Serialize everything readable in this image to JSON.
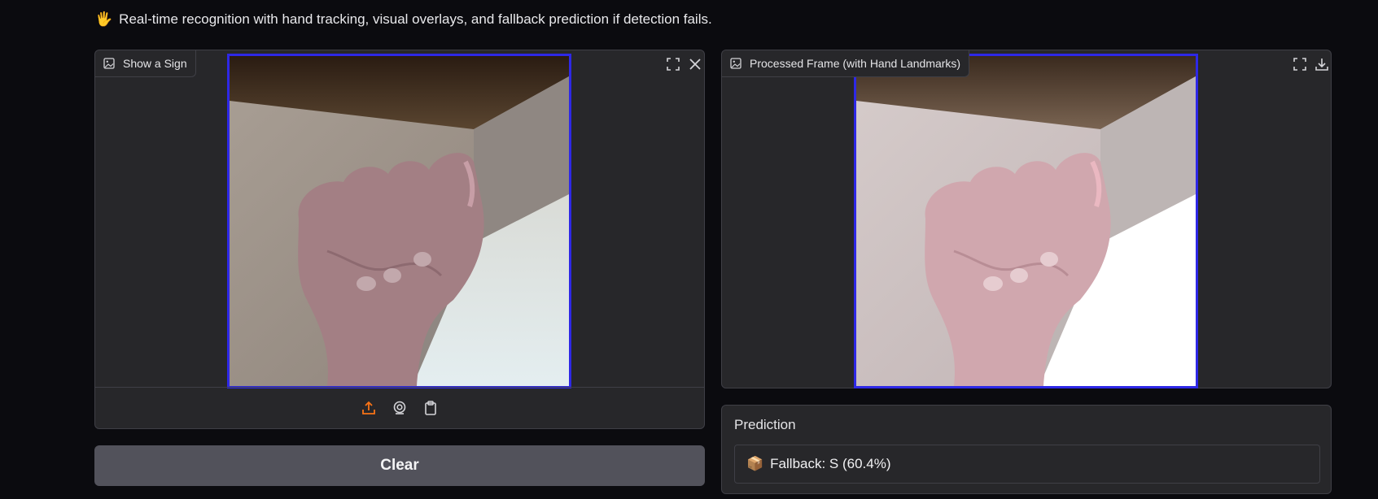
{
  "description": {
    "emoji": "🖐",
    "text": "Real-time recognition with hand tracking, visual overlays, and fallback prediction if detection fails."
  },
  "input_panel": {
    "label": "Show a Sign",
    "fullscreen_icon": "fullscreen-icon",
    "close_icon": "close-icon",
    "toolbar": [
      "upload-icon",
      "webcam-icon",
      "clipboard-icon"
    ]
  },
  "output_panel": {
    "label": "Processed Frame (with Hand Landmarks)",
    "fullscreen_icon": "fullscreen-icon",
    "download_icon": "download-icon"
  },
  "clear_button": {
    "label": "Clear"
  },
  "prediction": {
    "title": "Prediction",
    "emoji": "📦",
    "text": "Fallback: S (60.4%)"
  },
  "colors": {
    "background": "#0b0b0f",
    "panel": "#27272a",
    "frame_border": "#2e28e6",
    "upload_accent": "#f97316",
    "button": "#52525b"
  }
}
